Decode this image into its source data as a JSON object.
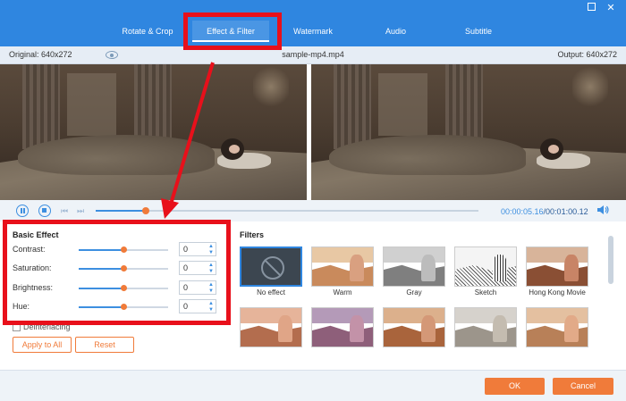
{
  "tabs": [
    {
      "label": "Rotate & Crop"
    },
    {
      "label": "Effect & Filter"
    },
    {
      "label": "Watermark"
    },
    {
      "label": "Audio"
    },
    {
      "label": "Subtitle"
    }
  ],
  "active_tab": "Effect & Filter",
  "window": {
    "maximize_icon": "maximize-icon",
    "close_glyph": "✕"
  },
  "info": {
    "original": "Original: 640x272",
    "filename": "sample-mp4.mp4",
    "output": "Output: 640x272"
  },
  "player": {
    "current_time": "00:00:05.16",
    "total_time": "/00:01:00.12",
    "progress": 0.13
  },
  "basic_effect": {
    "title": "Basic Effect",
    "sliders": [
      {
        "label": "Contrast:",
        "value": "0",
        "level": 0.5
      },
      {
        "label": "Saturation:",
        "value": "0",
        "level": 0.5
      },
      {
        "label": "Brightness:",
        "value": "0",
        "level": 0.5
      },
      {
        "label": "Hue:",
        "value": "0",
        "level": 0.5
      }
    ],
    "deinterlacing_label": "Deinterlacing",
    "apply_all": "Apply to All",
    "reset": "Reset"
  },
  "filters": {
    "title": "Filters",
    "items": [
      {
        "label": "No effect"
      },
      {
        "label": "Warm"
      },
      {
        "label": "Gray"
      },
      {
        "label": "Sketch"
      },
      {
        "label": "Hong Kong Movie"
      }
    ]
  },
  "footer": {
    "ok": "OK",
    "cancel": "Cancel"
  },
  "colors": {
    "accent": "#2f86e0",
    "orange": "#f07b3a",
    "annotation_red": "#e8101b"
  }
}
